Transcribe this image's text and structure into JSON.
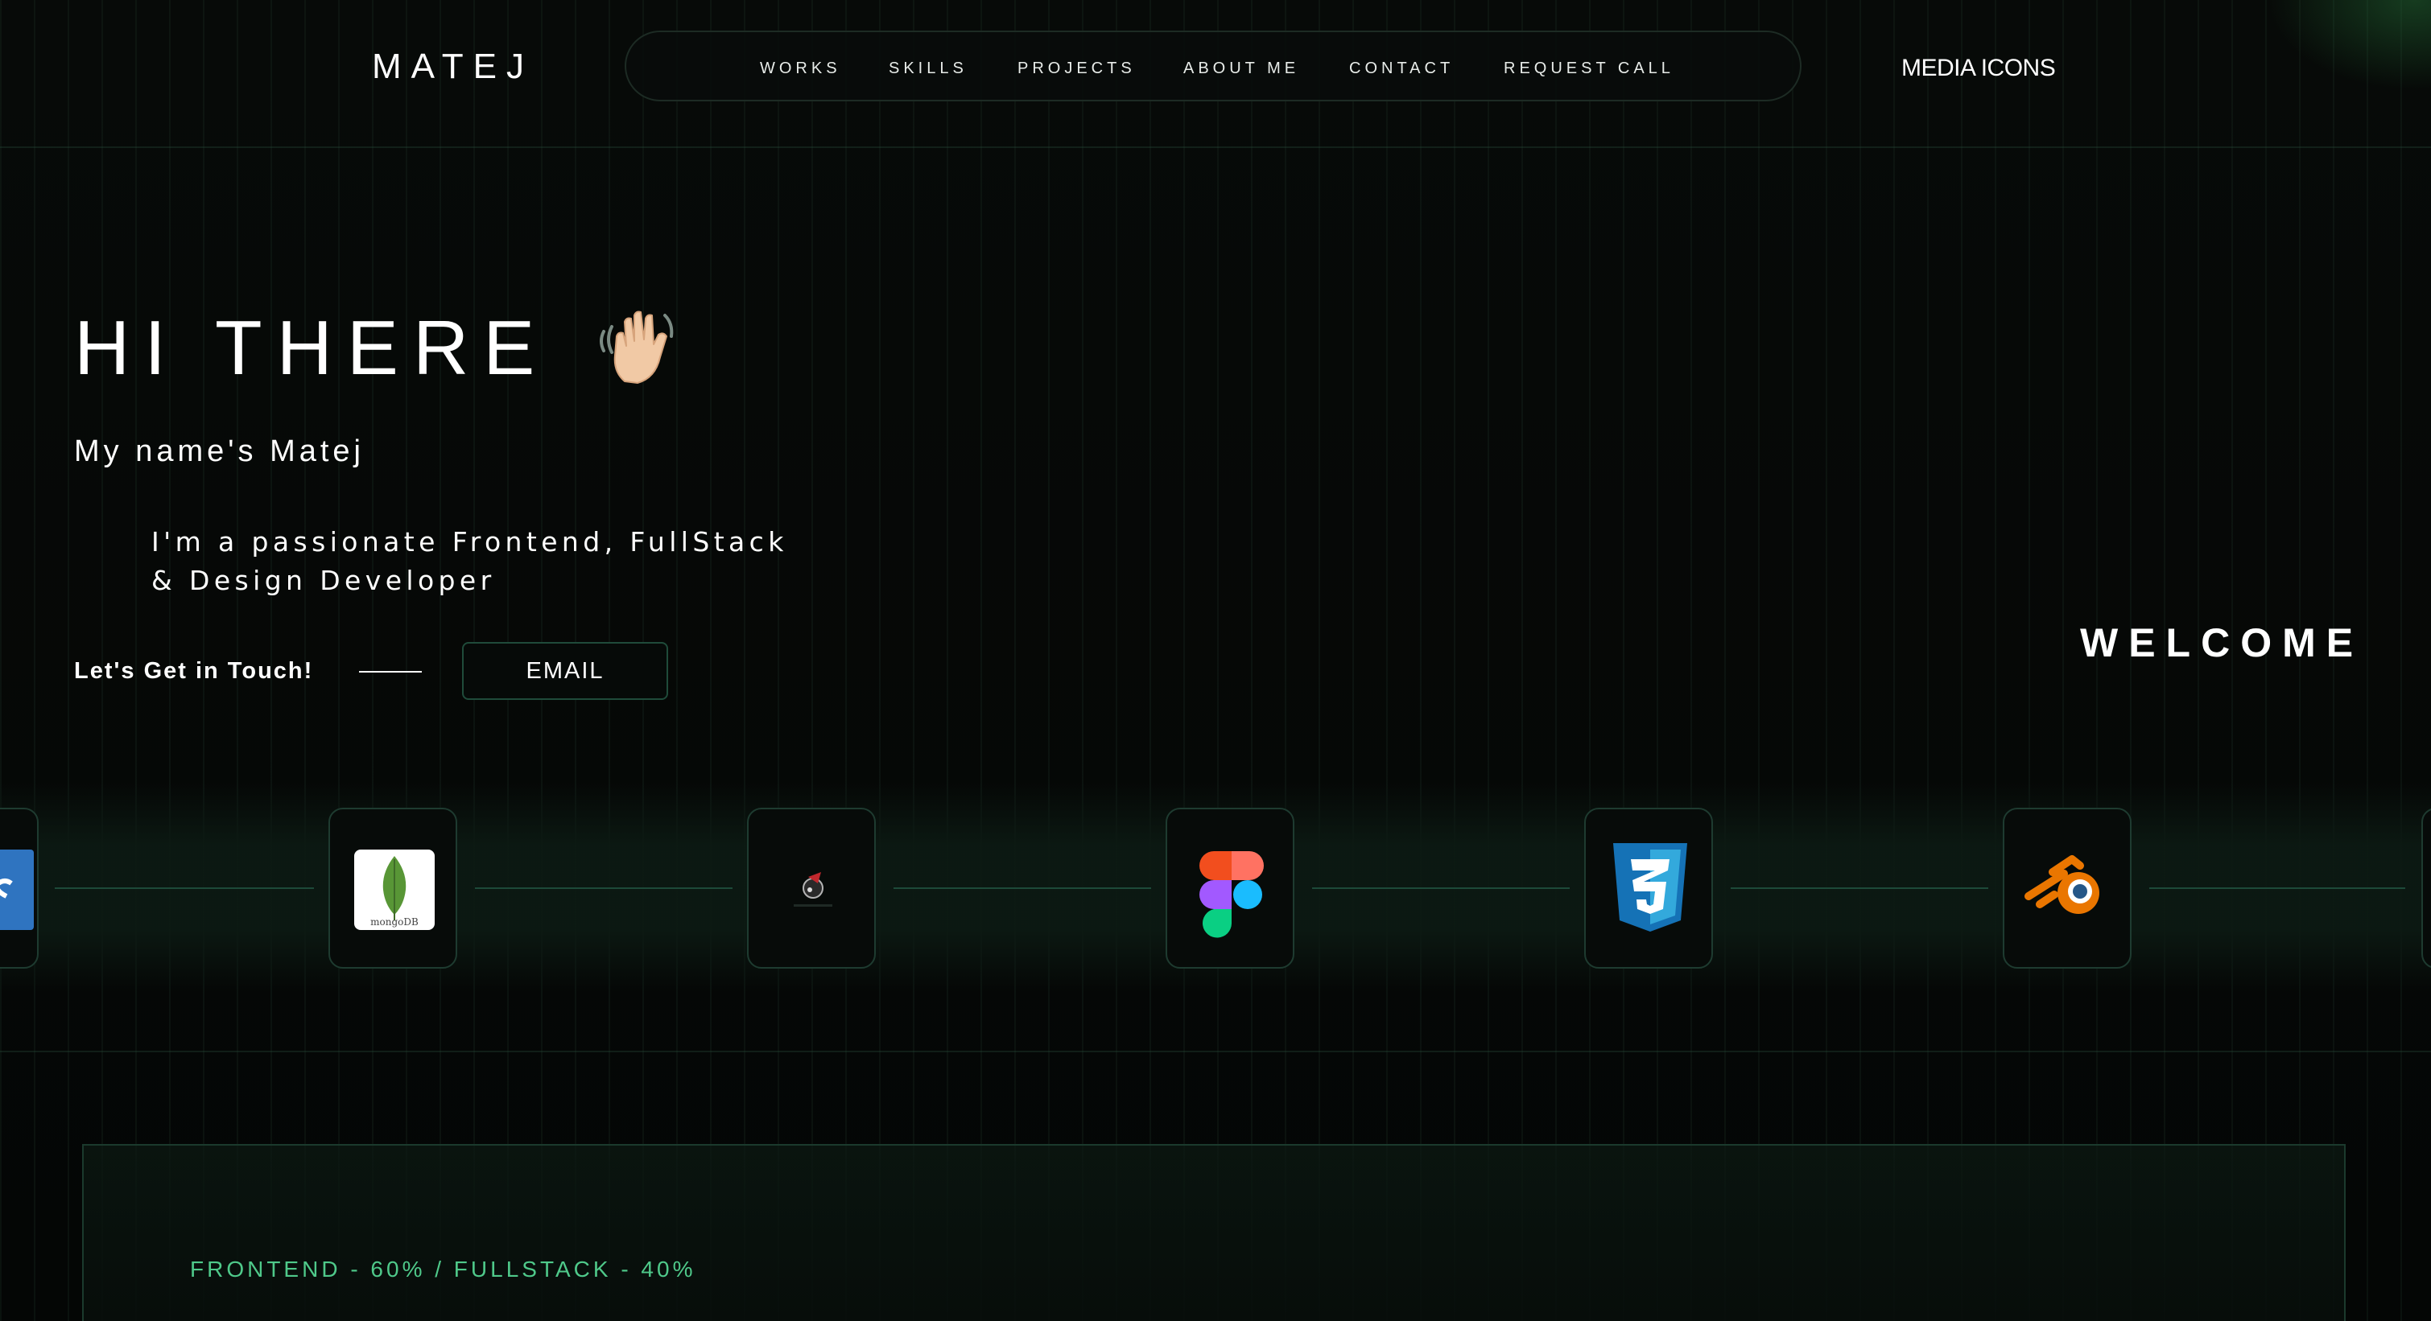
{
  "header": {
    "logo": "MATEJ",
    "nav": [
      {
        "label": "WORKS"
      },
      {
        "label": "SKILLS"
      },
      {
        "label": "PROJECTS"
      },
      {
        "label": "ABOUT ME"
      },
      {
        "label": "CONTACT"
      },
      {
        "label": "REQUEST CALL"
      }
    ],
    "media_icons_label": "MEDIA ICONS"
  },
  "hero": {
    "title": "HI THERE",
    "wave_icon": "waving-hand-icon",
    "name_line": "My name's Matej",
    "description_line1": "I'm a passionate Frontend, FullStack",
    "description_line2": "& Design Developer",
    "touch_label": "Let's Get in Touch!",
    "email_button": "EMAIL",
    "welcome": "WELCOME"
  },
  "tech_strip": {
    "items": [
      {
        "icon": "typescript-icon"
      },
      {
        "icon": "mongodb-icon",
        "caption": "mongoDB"
      },
      {
        "icon": "cypress-icon"
      },
      {
        "icon": "figma-icon"
      },
      {
        "icon": "css3-icon"
      },
      {
        "icon": "blender-icon"
      }
    ]
  },
  "skills": {
    "split_label": "FRONTEND - 60% / FULLSTACK - 40%",
    "frontend_percent": 60,
    "fullstack_percent": 40
  },
  "colors": {
    "background": "#050706",
    "accent_green": "#4fc98a",
    "border_green": "#1e3b30"
  }
}
